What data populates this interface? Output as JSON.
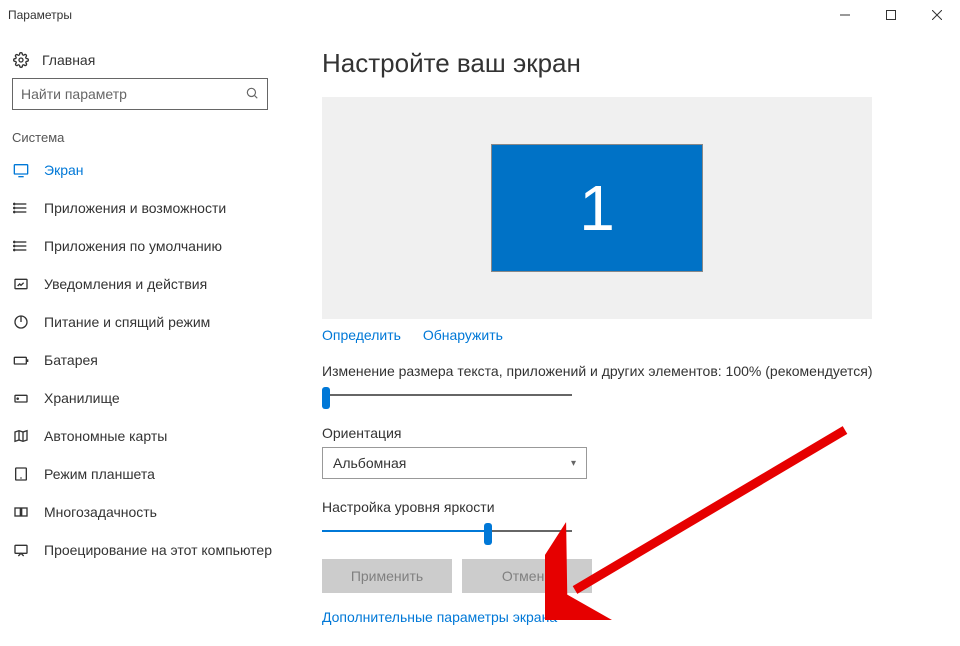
{
  "window": {
    "title": "Параметры"
  },
  "home": {
    "label": "Главная"
  },
  "search": {
    "placeholder": "Найти параметр"
  },
  "group": {
    "label": "Система"
  },
  "nav": {
    "items": [
      {
        "label": "Экран"
      },
      {
        "label": "Приложения и возможности"
      },
      {
        "label": "Приложения по умолчанию"
      },
      {
        "label": "Уведомления и действия"
      },
      {
        "label": "Питание и спящий режим"
      },
      {
        "label": "Батарея"
      },
      {
        "label": "Хранилище"
      },
      {
        "label": "Автономные карты"
      },
      {
        "label": "Режим планшета"
      },
      {
        "label": "Многозадачность"
      },
      {
        "label": "Проецирование на этот компьютер"
      }
    ]
  },
  "page": {
    "title": "Настройте ваш экран",
    "monitor_id": "1",
    "identify": "Определить",
    "detect": "Обнаружить",
    "scale_label": "Изменение размера текста, приложений и других элементов: 100% (рекомендуется)",
    "orientation_label": "Ориентация",
    "orientation_value": "Альбомная",
    "brightness_label": "Настройка уровня яркости",
    "apply": "Применить",
    "cancel": "Отмена",
    "advanced_link": "Дополнительные параметры экрана"
  }
}
